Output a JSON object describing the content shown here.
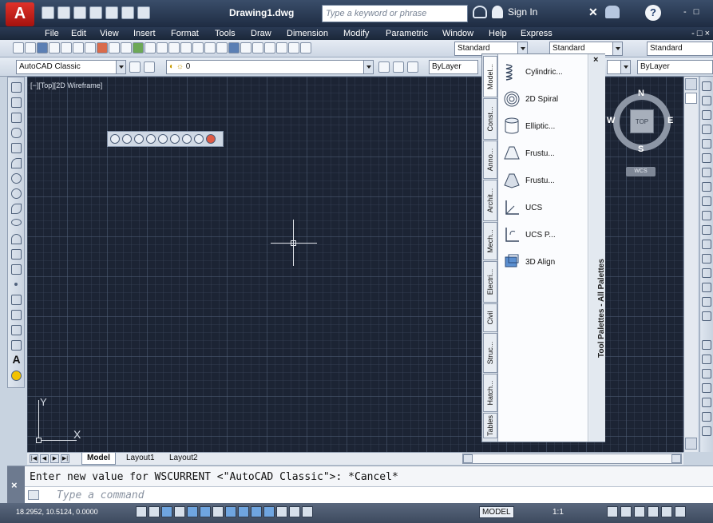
{
  "title_bar": {
    "document_title": "Drawing1.dwg",
    "search_placeholder": "Type a keyword or phrase",
    "sign_in": "Sign In",
    "help": "?",
    "window_controls": "- □"
  },
  "menu": {
    "items": [
      "File",
      "Edit",
      "View",
      "Insert",
      "Format",
      "Tools",
      "Draw",
      "Dimension",
      "Modify",
      "Parametric",
      "Window",
      "Help",
      "Express"
    ],
    "window_controls": "- □ ×"
  },
  "toolbars": {
    "text_style": "Standard",
    "dim_style": "Standard",
    "table_style": "Standard",
    "workspace": "AutoCAD Classic",
    "layer": "0",
    "color": "ByLayer",
    "linetype": "ByLayer",
    "lineweight": "ByLayer"
  },
  "viewport": {
    "label": "[−][Top][2D Wireframe]",
    "ucs_x": "X",
    "ucs_y": "Y"
  },
  "navcube": {
    "top": "TOP",
    "north": "N",
    "south": "S",
    "east": "E",
    "west": "W",
    "wcs": "WCS"
  },
  "tool_palette": {
    "title": "Tool Palettes - All Palettes",
    "close": "×",
    "tabs": [
      "Model...",
      "Const...",
      "Anno...",
      "Archit...",
      "Mech...",
      "Electri...",
      "Civil",
      "Struc...",
      "Hatch...",
      "Tables"
    ],
    "items": [
      "Cylindric...",
      "2D Spiral",
      "Elliptic...",
      "Frustu...",
      "Frustu...",
      "UCS",
      "UCS P...",
      "3D Align"
    ]
  },
  "layout_tabs": [
    "Model",
    "Layout1",
    "Layout2"
  ],
  "command": {
    "history": "Enter new value for WSCURRENT <\"AutoCAD Classic\">: *Cancel*",
    "placeholder": "Type a command"
  },
  "status": {
    "coordinates": "18.2952, 10.5124, 0.0000",
    "model": "MODEL",
    "scale": "1:1"
  }
}
